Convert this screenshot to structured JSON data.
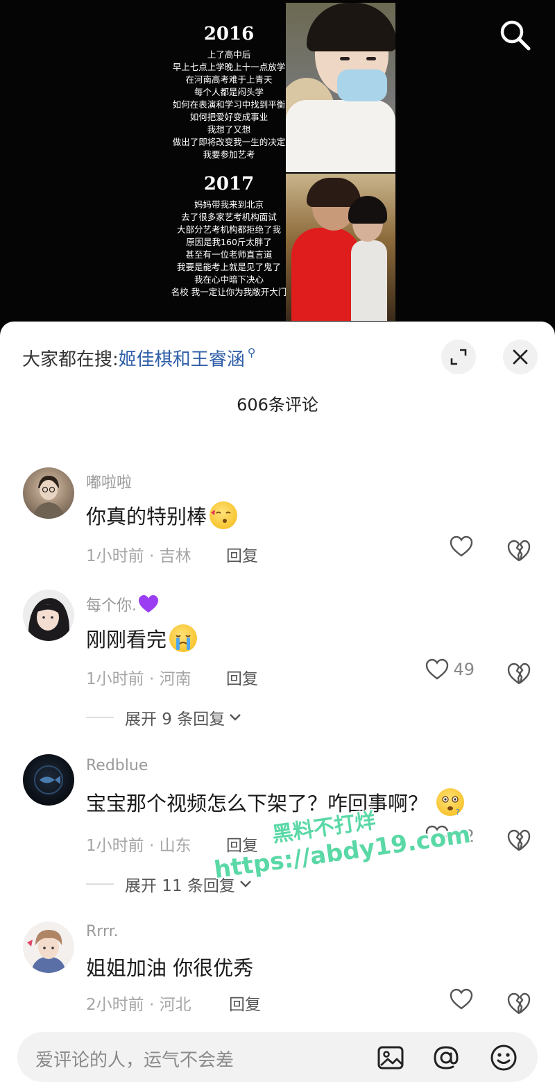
{
  "video": {
    "year_2016": "2016",
    "lines_2016": [
      "上了高中后",
      "早上七点上学晚上十一点放学",
      "在河南高考难于上青天",
      "每个人都是闷头学",
      "如何在表演和学习中找到平衡",
      "如何把爱好变成事业",
      "我想了又想",
      "做出了即将改变我一生的决定",
      "我要参加艺考"
    ],
    "year_2017": "2017",
    "lines_2017": [
      "妈妈带我来到北京",
      "去了很多家艺考机构面试",
      "大部分艺考机构都拒绝了我",
      "原因是我160斤太胖了",
      "甚至有一位老师直言道",
      "我要是能考上就是见了鬼了",
      "我在心中暗下决心",
      "名校 我一定让你为我敞开大门"
    ],
    "search_icon": "search-icon"
  },
  "panel": {
    "hot_search_prefix": "大家都在搜:",
    "hot_search_link": "姬佳棋和王睿涵",
    "comment_count": "606条评论",
    "reply_label": "回复"
  },
  "comments": [
    {
      "name": "嘟啦啦",
      "text": "你真的特别棒",
      "time_loc": "1小时前 · 吉林",
      "likes": ""
    },
    {
      "name": "每个你.",
      "text": "刚刚看完",
      "time_loc": "1小时前 · 河南",
      "likes": "49",
      "expand": "展开 9 条回复"
    },
    {
      "name": "Redblue",
      "text": "宝宝那个视频怎么下架了？咋回事啊？",
      "time_loc": "1小时前 · 山东",
      "likes": "72",
      "expand": "展开 11 条回复"
    },
    {
      "name": "Rrrr.",
      "text": "姐姐加油 你很优秀",
      "time_loc": "2小时前 · 河北",
      "likes": ""
    }
  ],
  "watermark": {
    "line1": "黑料不打烊",
    "line2": "https://abdy19.com"
  },
  "input": {
    "placeholder": "爱评论的人，运气不会差"
  },
  "colors": {
    "link": "#2f5ea8",
    "watermark": "#5ad8a6",
    "purple_heart": "#9b3df2"
  }
}
